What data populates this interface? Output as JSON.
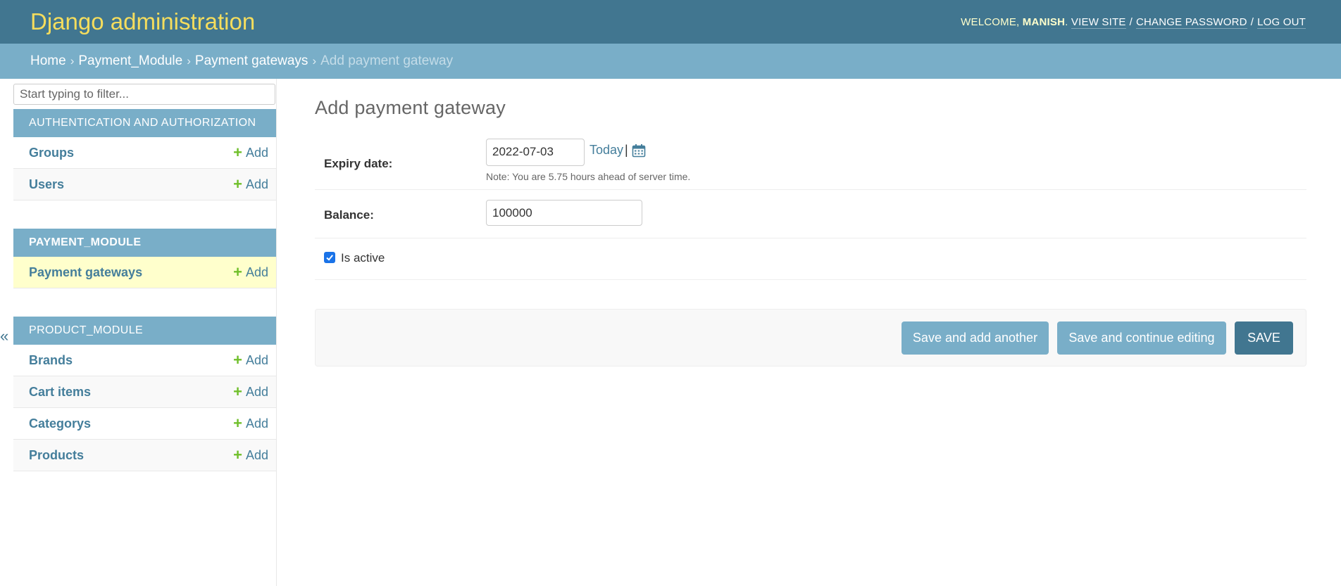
{
  "header": {
    "branding": "Django administration",
    "welcome": "WELCOME, ",
    "username": "MANISH",
    "after_name": ". ",
    "view_site": "VIEW SITE",
    "separator": "/",
    "change_password": "CHANGE PASSWORD",
    "log_out": "LOG OUT"
  },
  "breadcrumbs": {
    "home": "Home",
    "module": "Payment_Module",
    "model": "Payment gateways",
    "current": "Add payment gateway",
    "arrow": "›"
  },
  "sidebar": {
    "filter_placeholder": "Start typing to filter...",
    "toggle": "«",
    "add_label": "Add",
    "plus": "+",
    "modules": [
      {
        "caption": "AUTHENTICATION AND AUTHORIZATION",
        "items": [
          {
            "label": "Groups"
          },
          {
            "label": "Users"
          }
        ]
      },
      {
        "caption": "PAYMENT_MODULE",
        "items": [
          {
            "label": "Payment gateways"
          }
        ]
      },
      {
        "caption": "PRODUCT_MODULE",
        "items": [
          {
            "label": "Brands"
          },
          {
            "label": "Cart items"
          },
          {
            "label": "Categorys"
          },
          {
            "label": "Products"
          }
        ]
      }
    ]
  },
  "content": {
    "title": "Add payment gateway",
    "expiry": {
      "label": "Expiry date:",
      "value": "2022-07-03",
      "today": "Today",
      "pipe": "|",
      "help": "Note: You are 5.75 hours ahead of server time."
    },
    "balance": {
      "label": "Balance:",
      "value": "100000"
    },
    "is_active": {
      "label": "Is active",
      "checked": true
    },
    "buttons": {
      "save_add_another": "Save and add another",
      "save_continue": "Save and continue editing",
      "save": "SAVE"
    }
  },
  "colors": {
    "header_bg": "#417690",
    "breadcrumb_bg": "#79aec8",
    "branding": "#f5dd5d",
    "link": "#447e9b",
    "add_plus": "#70bf2b",
    "current_row": "#ffffcc"
  }
}
